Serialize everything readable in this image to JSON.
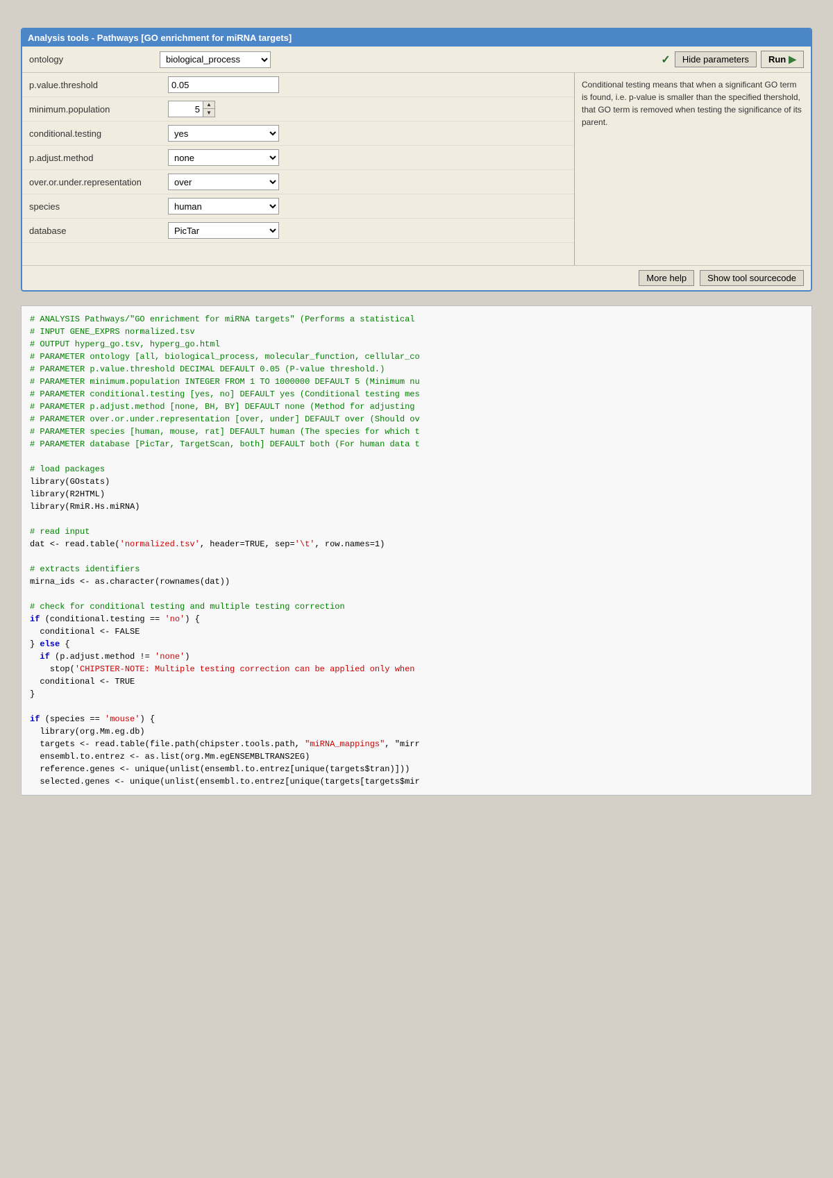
{
  "panel": {
    "title": "Analysis tools - Pathways [GO enrichment for miRNA targets]",
    "toolbar": {
      "ontology_label": "ontology",
      "ontology_value": "biological_process",
      "ontology_options": [
        "all",
        "biological_process",
        "molecular_function",
        "cellular_component"
      ],
      "hide_params_label": "Hide parameters",
      "run_label": "Run"
    },
    "params": [
      {
        "label": "p.value.threshold",
        "type": "text",
        "value": "0.05"
      },
      {
        "label": "minimum.population",
        "type": "spinner",
        "value": "5"
      },
      {
        "label": "conditional.testing",
        "type": "select",
        "value": "yes",
        "options": [
          "yes",
          "no"
        ]
      },
      {
        "label": "p.adjust.method",
        "type": "select",
        "value": "none",
        "options": [
          "none",
          "BH",
          "BY"
        ]
      },
      {
        "label": "over.or.under.representation",
        "type": "select",
        "value": "over",
        "options": [
          "over",
          "under"
        ]
      },
      {
        "label": "species",
        "type": "select",
        "value": "human",
        "options": [
          "human",
          "mouse",
          "rat"
        ]
      },
      {
        "label": "database",
        "type": "select",
        "value": "PicTar",
        "options": [
          "PicTar",
          "TargetScan",
          "both"
        ]
      }
    ],
    "help_text": "Conditional testing means that when a significant GO term is found, i.e. p-value is smaller than the specified thershold, that GO term is removed when testing the significance of its parent.",
    "bottom_buttons": {
      "more_help": "More help",
      "show_source": "Show tool sourcecode"
    }
  },
  "code": {
    "lines": [
      {
        "type": "comment",
        "text": "# ANALYSIS Pathways/\"GO enrichment for miRNA targets\" (Performs a statistical"
      },
      {
        "type": "comment",
        "text": "# INPUT GENE_EXPRS normalized.tsv"
      },
      {
        "type": "comment",
        "text": "# OUTPUT hyperg_go.tsv, hyperg_go.html"
      },
      {
        "type": "comment",
        "text": "# PARAMETER ontology [all, biological_process, molecular_function, cellular_co"
      },
      {
        "type": "comment",
        "text": "# PARAMETER p.value.threshold DECIMAL DEFAULT 0.05 (P-value threshold.)"
      },
      {
        "type": "comment",
        "text": "# PARAMETER minimum.population INTEGER FROM 1 TO 1000000 DEFAULT 5 (Minimum nu"
      },
      {
        "type": "comment",
        "text": "# PARAMETER conditional.testing [yes, no] DEFAULT yes (Conditional testing mes"
      },
      {
        "type": "comment",
        "text": "# PARAMETER p.adjust.method [none, BH, BY] DEFAULT none (Method for adjusting"
      },
      {
        "type": "comment",
        "text": "# PARAMETER over.or.under.representation [over, under] DEFAULT over (Should ov"
      },
      {
        "type": "comment",
        "text": "# PARAMETER species [human, mouse, rat] DEFAULT human (The species for which t"
      },
      {
        "type": "comment",
        "text": "# PARAMETER database [PicTar, TargetScan, both] DEFAULT both (For human data t"
      },
      {
        "type": "empty",
        "text": ""
      },
      {
        "type": "comment",
        "text": "# load packages"
      },
      {
        "type": "normal",
        "text": "library(GOstats)"
      },
      {
        "type": "normal",
        "text": "library(R2HTML)"
      },
      {
        "type": "normal",
        "text": "library(RmiR.Hs.miRNA)"
      },
      {
        "type": "empty",
        "text": ""
      },
      {
        "type": "comment",
        "text": "# read input"
      },
      {
        "type": "mixed",
        "parts": [
          {
            "style": "normal",
            "text": "dat <- read.table("
          },
          {
            "style": "string",
            "text": "'normalized.tsv'"
          },
          {
            "style": "normal",
            "text": ", header=TRUE, sep="
          },
          {
            "style": "string",
            "text": "'\\t'"
          },
          {
            "style": "normal",
            "text": ", row.names=1)"
          }
        ]
      },
      {
        "type": "empty",
        "text": ""
      },
      {
        "type": "comment",
        "text": "# extracts identifiers"
      },
      {
        "type": "normal",
        "text": "mirna_ids <- as.character(rownames(dat))"
      },
      {
        "type": "empty",
        "text": ""
      },
      {
        "type": "comment",
        "text": "# check for conditional testing and multiple testing correction"
      },
      {
        "type": "mixed",
        "parts": [
          {
            "style": "keyword",
            "text": "if"
          },
          {
            "style": "normal",
            "text": " (conditional.testing == "
          },
          {
            "style": "string",
            "text": "'no'"
          },
          {
            "style": "normal",
            "text": ") {"
          }
        ]
      },
      {
        "type": "normal",
        "text": "  conditional <- FALSE"
      },
      {
        "type": "mixed",
        "parts": [
          {
            "style": "normal",
            "text": "} "
          },
          {
            "style": "keyword",
            "text": "else"
          },
          {
            "style": "normal",
            "text": " {"
          }
        ]
      },
      {
        "type": "mixed",
        "parts": [
          {
            "style": "keyword",
            "text": "  if"
          },
          {
            "style": "normal",
            "text": " (p.adjust.method != "
          },
          {
            "style": "string",
            "text": "'none'"
          },
          {
            "style": "normal",
            "text": ")"
          }
        ]
      },
      {
        "type": "mixed",
        "parts": [
          {
            "style": "normal",
            "text": "    stop("
          },
          {
            "style": "string",
            "text": "'CHIPSTER-NOTE: Multiple testing correction can be applied only when"
          },
          {
            "style": "normal",
            "text": ""
          }
        ]
      },
      {
        "type": "normal",
        "text": "  conditional <- TRUE"
      },
      {
        "type": "normal",
        "text": "}"
      },
      {
        "type": "empty",
        "text": ""
      },
      {
        "type": "mixed",
        "parts": [
          {
            "style": "keyword",
            "text": "if"
          },
          {
            "style": "normal",
            "text": " (species == "
          },
          {
            "style": "string",
            "text": "'mouse'"
          },
          {
            "style": "normal",
            "text": ") {"
          }
        ]
      },
      {
        "type": "normal",
        "text": "  library(org.Mm.eg.db)"
      },
      {
        "type": "mixed",
        "parts": [
          {
            "style": "normal",
            "text": "  targets <- read.table(file.path(chipster.tools.path, "
          },
          {
            "style": "string",
            "text": "\"miRNA_mappings\""
          },
          {
            "style": "normal",
            "text": ", \"mirr"
          }
        ]
      },
      {
        "type": "normal",
        "text": "  ensembl.to.entrez <- as.list(org.Mm.egENSEMBLTRANS2EG)"
      },
      {
        "type": "normal",
        "text": "  reference.genes <- unique(unlist(ensembl.to.entrez[unique(targets$tran)]))"
      },
      {
        "type": "normal",
        "text": "  selected.genes <- unique(unlist(ensembl.to.entrez[unique(targets[targets$mir"
      }
    ]
  }
}
